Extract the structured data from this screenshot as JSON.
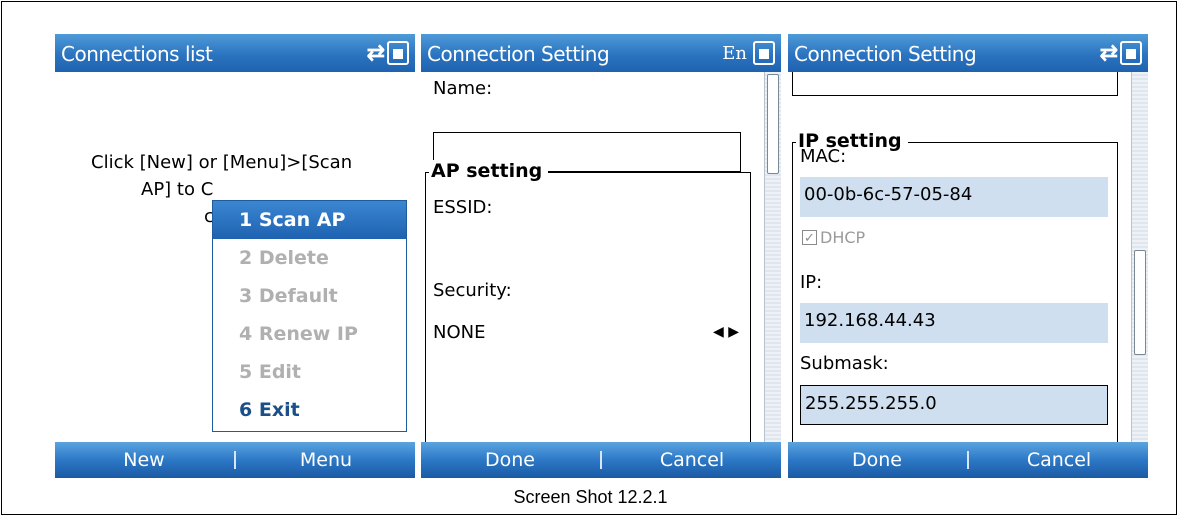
{
  "caption": "Screen Shot 12.2.1",
  "screen1": {
    "title": "Connections list",
    "message": "Click [New] or [Menu]>[Scan AP] to Create a new connection.",
    "msg_line1": "Click [New] or [Menu]>[Scan",
    "msg_line2a": "AP] to C",
    "msg_line3a": "con",
    "menu": [
      {
        "label": "1 Scan AP",
        "state": "selected"
      },
      {
        "label": "2 Delete",
        "state": "disabled"
      },
      {
        "label": "3 Default",
        "state": "disabled"
      },
      {
        "label": "4 Renew IP",
        "state": "disabled"
      },
      {
        "label": "5 Edit",
        "state": "disabled"
      },
      {
        "label": "6 Exit",
        "state": "enabled"
      }
    ],
    "softkey_left": "New",
    "softkey_right": "Menu"
  },
  "screen2": {
    "title": "Connection Setting",
    "input_indicator": "En",
    "name_label": "Name:",
    "name_value": "",
    "group_title": "AP setting",
    "essid_label": "ESSID:",
    "security_label": "Security:",
    "security_value": "NONE",
    "softkey_left": "Done",
    "softkey_right": "Cancel"
  },
  "screen3": {
    "title": "Connection Setting",
    "group_title": "IP setting",
    "mac_label": "MAC:",
    "mac_value": "00-0b-6c-57-05-84",
    "dhcp_label": "DHCP",
    "dhcp_checked": true,
    "ip_label": "IP:",
    "ip_value": "192.168.44.43",
    "submask_label": "Submask:",
    "submask_value": "255.255.255.0",
    "softkey_left": "Done",
    "softkey_right": "Cancel"
  },
  "colors": {
    "titlebar": "#2b74c0",
    "field_bg": "#cfdff0",
    "menu_selected": "#1e62b0"
  }
}
